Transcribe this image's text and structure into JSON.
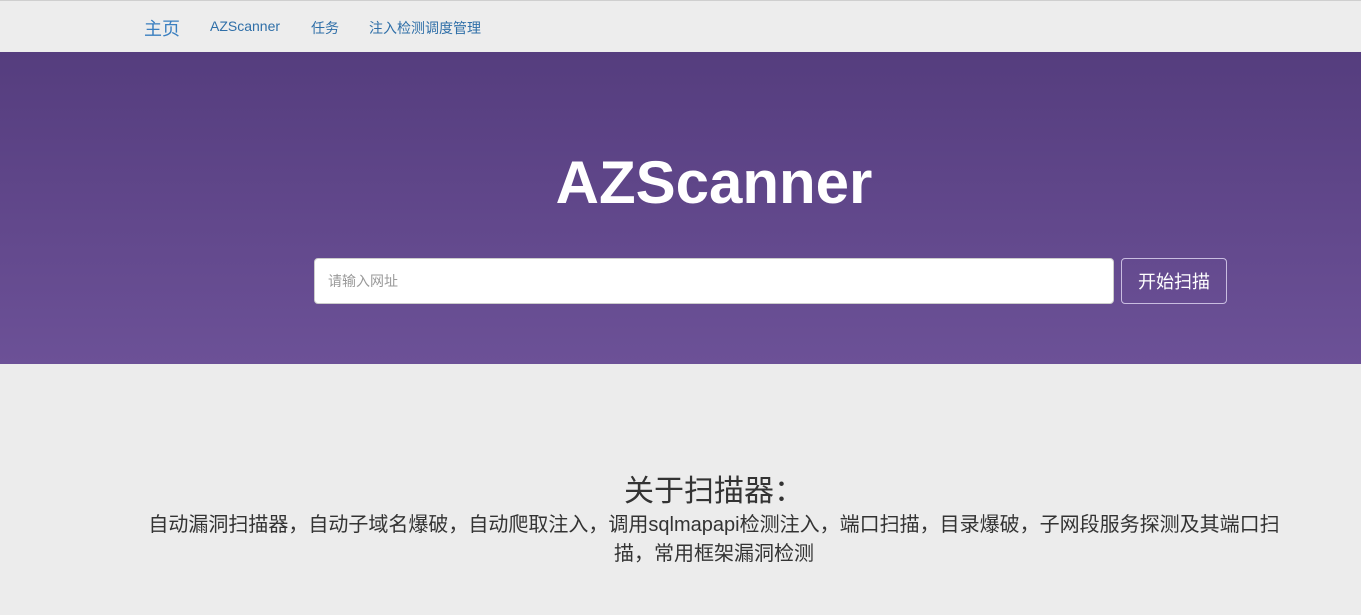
{
  "navbar": {
    "brand": "主页",
    "links": [
      "AZScanner",
      "任务",
      "注入检测调度管理"
    ]
  },
  "hero": {
    "title": "AZScanner",
    "input_placeholder": "请输入网址",
    "input_value": "",
    "button_label": "开始扫描"
  },
  "about": {
    "heading": "关于扫描器：",
    "description": "自动漏洞扫描器，自动子域名爆破，自动爬取注入，调用sqlmapapi检测注入，端口扫描，目录爆破，子网段服务探测及其端口扫描，常用框架漏洞检测"
  },
  "colors": {
    "hero_top": "#553d7e",
    "hero_bottom": "#6c5197",
    "link": "#2f6fa8",
    "background": "#ececec"
  }
}
